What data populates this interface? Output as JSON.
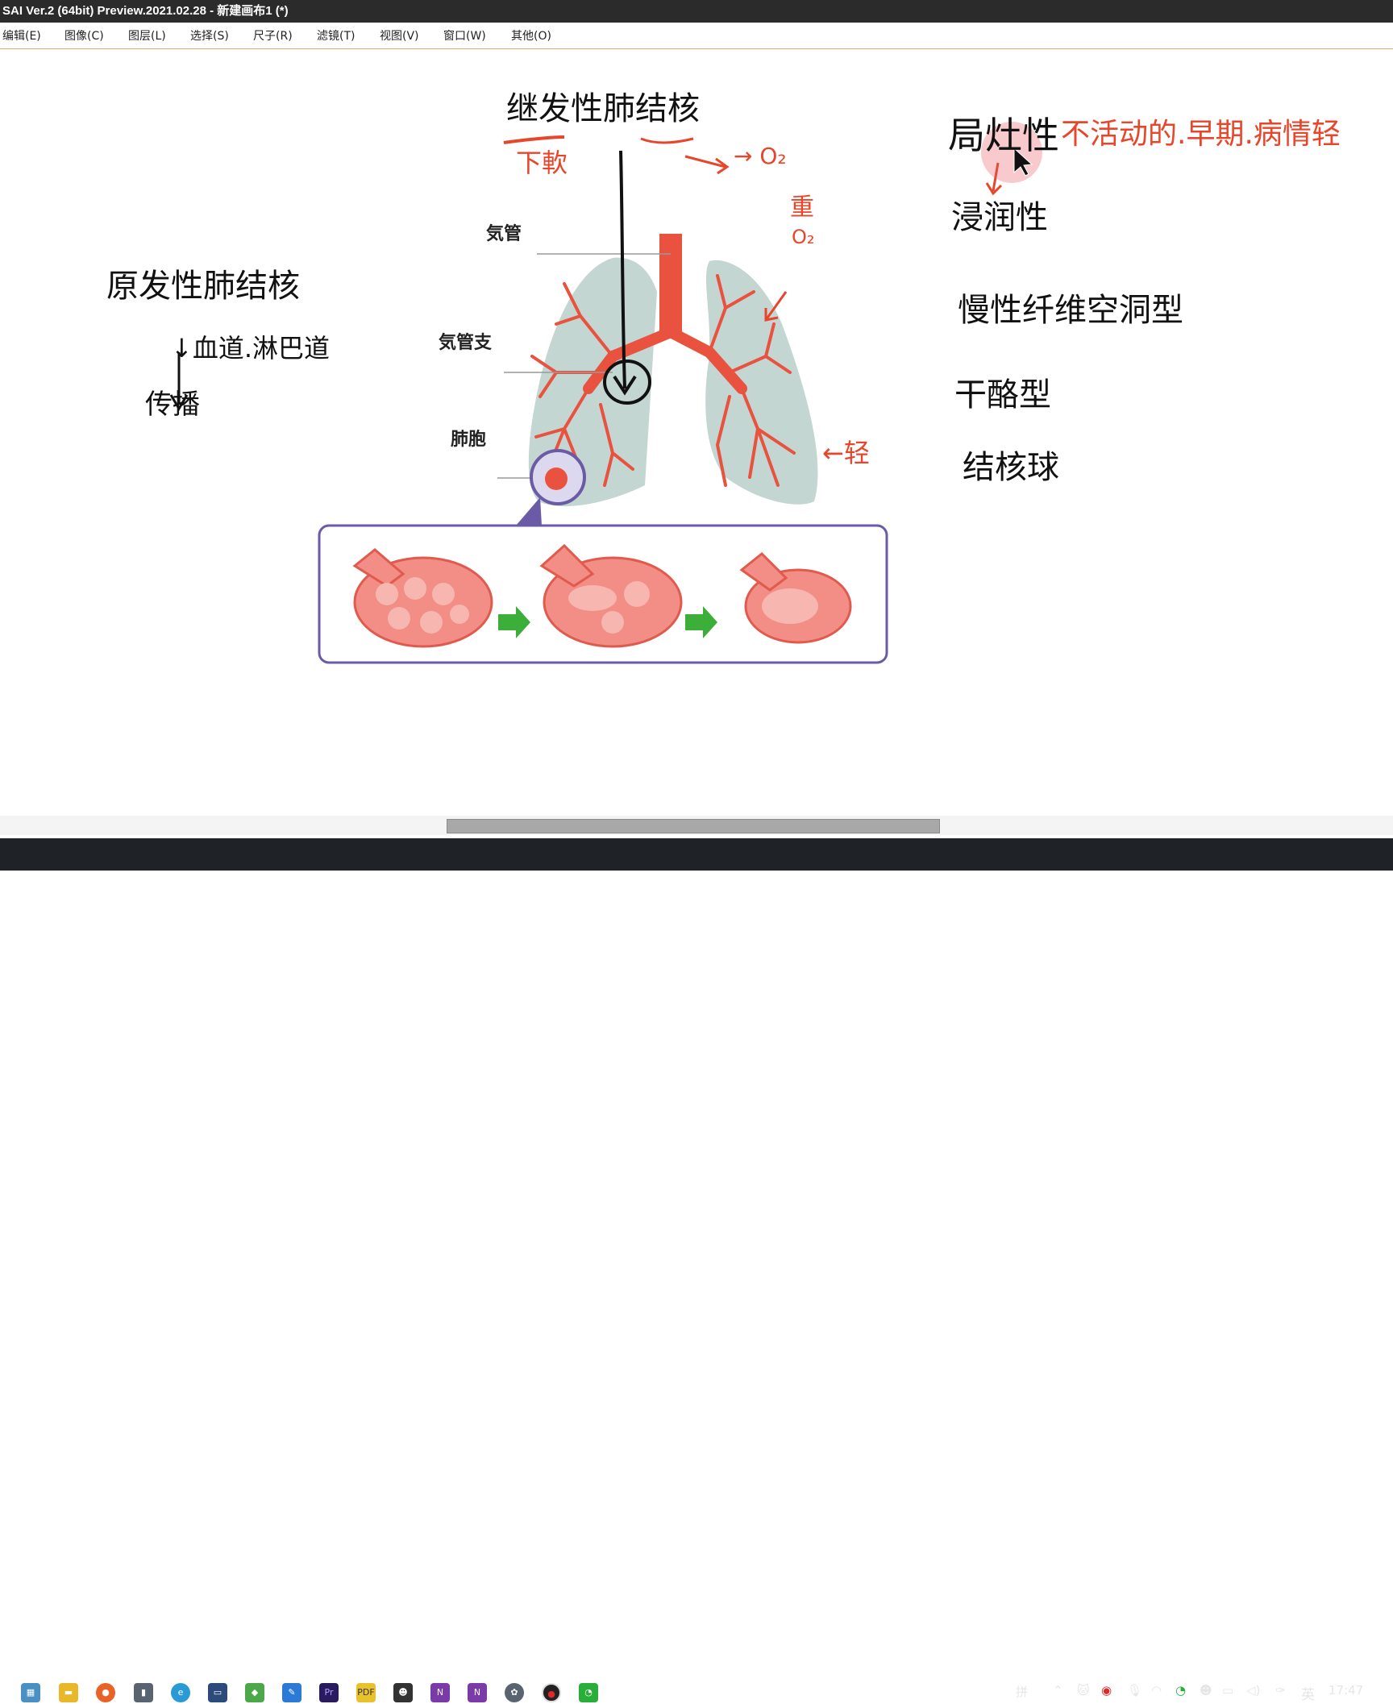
{
  "window": {
    "title": "SAI Ver.2 (64bit) Preview.2021.02.28 - 新建画布1 (*)"
  },
  "menu": [
    "编辑(E)",
    "图像(C)",
    "图层(L)",
    "选择(S)",
    "尺子(R)",
    "滤镜(T)",
    "视图(V)",
    "窗口(W)",
    "其他(O)"
  ],
  "diagram_labels": {
    "trachea": "気管",
    "bronchus": "気管支",
    "alveoli": "肺胞"
  },
  "notes_left": {
    "title": "原发性肺结核",
    "arrow_text": "↓血道.淋巴道",
    "spread": "传播"
  },
  "notes_top": {
    "title": "继发性肺结核",
    "left_red": "下軟",
    "arrow_o2": "→ O₂",
    "heavy": "重",
    "heavy_o2": "O₂",
    "light": "←轻"
  },
  "notes_right": {
    "focal": "局灶性",
    "focal_desc": "不活动的.早期.病情轻",
    "infiltrative": "浸润性",
    "chronic": "慢性纤维空洞型",
    "caseous": "干酪型",
    "tuberculoma": "结核球"
  },
  "taskbar": {
    "apps": [
      "file-explorer-icon",
      "folder-icon",
      "firefox-icon",
      "usb-icon",
      "edge-icon",
      "monitor-icon",
      "maps-icon",
      "pen-icon",
      "premiere-icon",
      "pdf-icon",
      "qq-icon",
      "onenote-icon",
      "onenote-icon-2",
      "sai-icon",
      "recorder-icon",
      "wechat-icon"
    ],
    "ime1": "拼",
    "ime2": "英",
    "time": "17:47"
  },
  "colors": {
    "accent_red": "#e8452a",
    "lung_fill": "#c4d6d2",
    "box_border": "#6b5ba6",
    "arrow_green": "#3cae3a"
  }
}
